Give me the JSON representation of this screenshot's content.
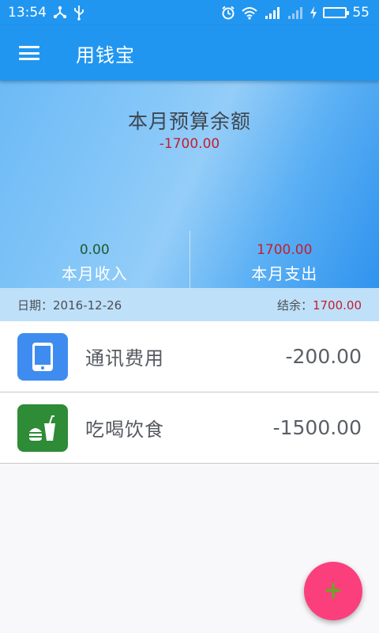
{
  "status_bar": {
    "time": "13:54",
    "battery": "55",
    "battery_level": 0.55
  },
  "app_bar": {
    "title": "用钱宝"
  },
  "summary": {
    "title": "本月预算余额",
    "balance": "-1700.00",
    "income_value": "0.00",
    "income_label": "本月收入",
    "expense_value": "1700.00",
    "expense_label": "本月支出"
  },
  "date_bar": {
    "date_label": "日期：",
    "date": "2016-12-26",
    "remain_label": "结余：",
    "remain": "1700.00"
  },
  "records": [
    {
      "category": "通讯费用",
      "amount": "-200.00",
      "icon": "tablet-icon",
      "color": "#3e8cf0"
    },
    {
      "category": "吃喝饮食",
      "amount": "-1500.00",
      "icon": "food-drink-icon",
      "color": "#2e8b36"
    }
  ],
  "fab": {
    "symbol": "+",
    "color": "#fb3f7d"
  }
}
